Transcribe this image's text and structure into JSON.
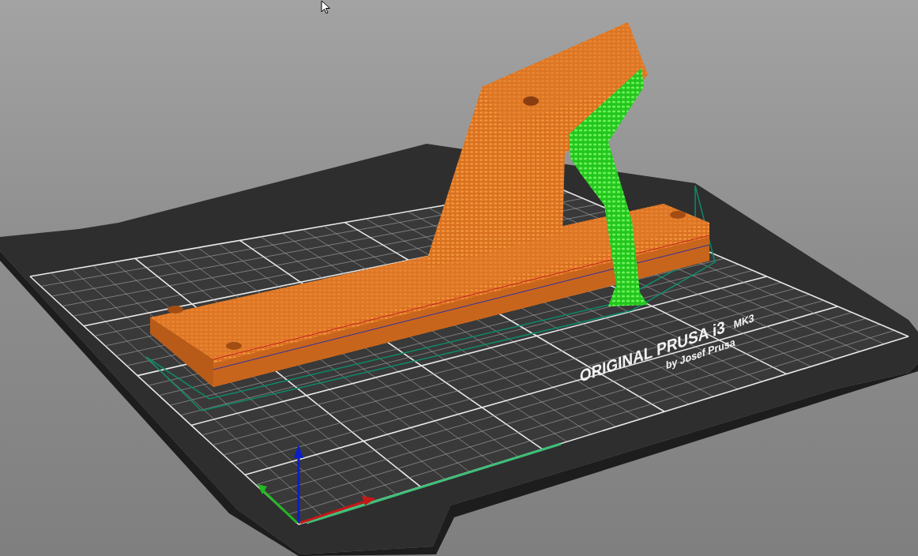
{
  "bed_label": {
    "title": "ORIGINAL PRUSA i3",
    "model": "MK3",
    "subtitle": "by Josef Prusa"
  }
}
